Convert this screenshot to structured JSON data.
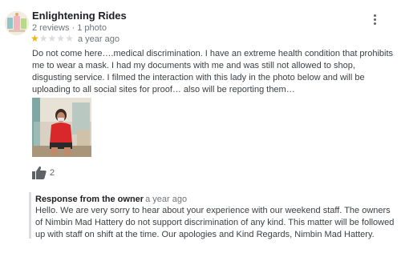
{
  "review": {
    "author": "Enlightening Rides",
    "meta": "2 reviews · 1 photo",
    "rating": 1,
    "rating_max": 5,
    "time": "a year ago",
    "text": "Do not come here….medical discrimination. I have an extreme  health condition that prohibits me to wear a mask. I had my documents with me and was still not allowed to shop, disgusting service. I filmed the interaction with this lady in the photo below and will be uploading to all social sites for proof… also will be reporting them…",
    "likes": "2",
    "icons": {
      "avatar": "avatar-image",
      "more": "more-vert-icon",
      "like": "thumbs-up-icon",
      "star": "star-icon"
    },
    "colors": {
      "star_filled": "#f4b400",
      "star_empty": "#dadce0",
      "meta_text": "#70757a"
    }
  },
  "response": {
    "heading": "Response from the owner",
    "time": "a year ago",
    "text": "Hello. We are very sorry to hear about your experience with our weekend staff. The owners of Nimbin Mad Hattery do not support discrimination of any kind. This matter will be followed up with staff on shift at the time. Our apologies and Kind Regards, Nimbin Mad Hattery."
  }
}
